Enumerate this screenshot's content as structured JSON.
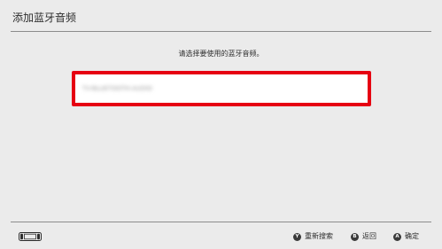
{
  "header": {
    "title": "添加蓝牙音频"
  },
  "main": {
    "prompt": "请选择要使用的蓝牙音频。",
    "devices": [
      {
        "name": "TV-BLUETOOTH-AUDIO",
        "selected": true
      }
    ]
  },
  "footer": {
    "controller_icon": "joycon-controller-icon",
    "actions": [
      {
        "button": "Y",
        "label": "重新搜索"
      },
      {
        "button": "B",
        "label": "返回"
      },
      {
        "button": "A",
        "label": "确定"
      }
    ]
  },
  "colors": {
    "background": "#ebebeb",
    "selection_highlight": "#e60012",
    "text": "#2d2d2d"
  }
}
